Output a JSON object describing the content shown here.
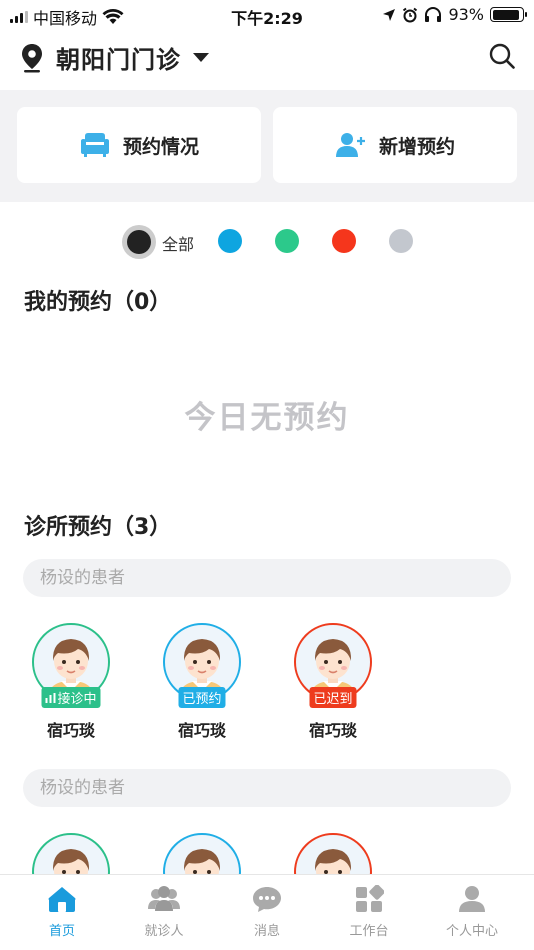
{
  "status_bar": {
    "carrier": "中国移动",
    "time": "下午2:29",
    "battery": "93%",
    "battery_level": 0.93
  },
  "header": {
    "location": "朝阳门门诊"
  },
  "actions": {
    "appointments_label": "预约情况",
    "new_label": "新增预约"
  },
  "filter": {
    "all_label": "全部",
    "colors": [
      "#222222",
      "#0ea5e0",
      "#2cc98b",
      "#f5361c",
      "#c3c7ce"
    ]
  },
  "my_section": {
    "title": "我的预约（0）",
    "empty_text": "今日无预约"
  },
  "clinic_section": {
    "title": "诊所预约（3）"
  },
  "groups": [
    {
      "label": "杨设的患者",
      "patients": [
        {
          "name": "宿巧琰",
          "status": "接诊中",
          "color": "#2cc08a"
        },
        {
          "name": "宿巧琰",
          "status": "已预约",
          "color": "#20aee6"
        },
        {
          "name": "宿巧琰",
          "status": "已迟到",
          "color": "#ee3c1e"
        }
      ]
    },
    {
      "label": "杨设的患者",
      "patients": [
        {
          "color": "#2cc08a"
        },
        {
          "color": "#20aee6"
        },
        {
          "color": "#ee3c1e"
        }
      ]
    }
  ],
  "tabs": [
    {
      "label": "首页",
      "icon": "home-icon",
      "active": true
    },
    {
      "label": "就诊人",
      "icon": "people-icon",
      "active": false
    },
    {
      "label": "消息",
      "icon": "message-icon",
      "active": false
    },
    {
      "label": "工作台",
      "icon": "workbench-icon",
      "active": false
    },
    {
      "label": "个人中心",
      "icon": "profile-icon",
      "active": false
    }
  ]
}
